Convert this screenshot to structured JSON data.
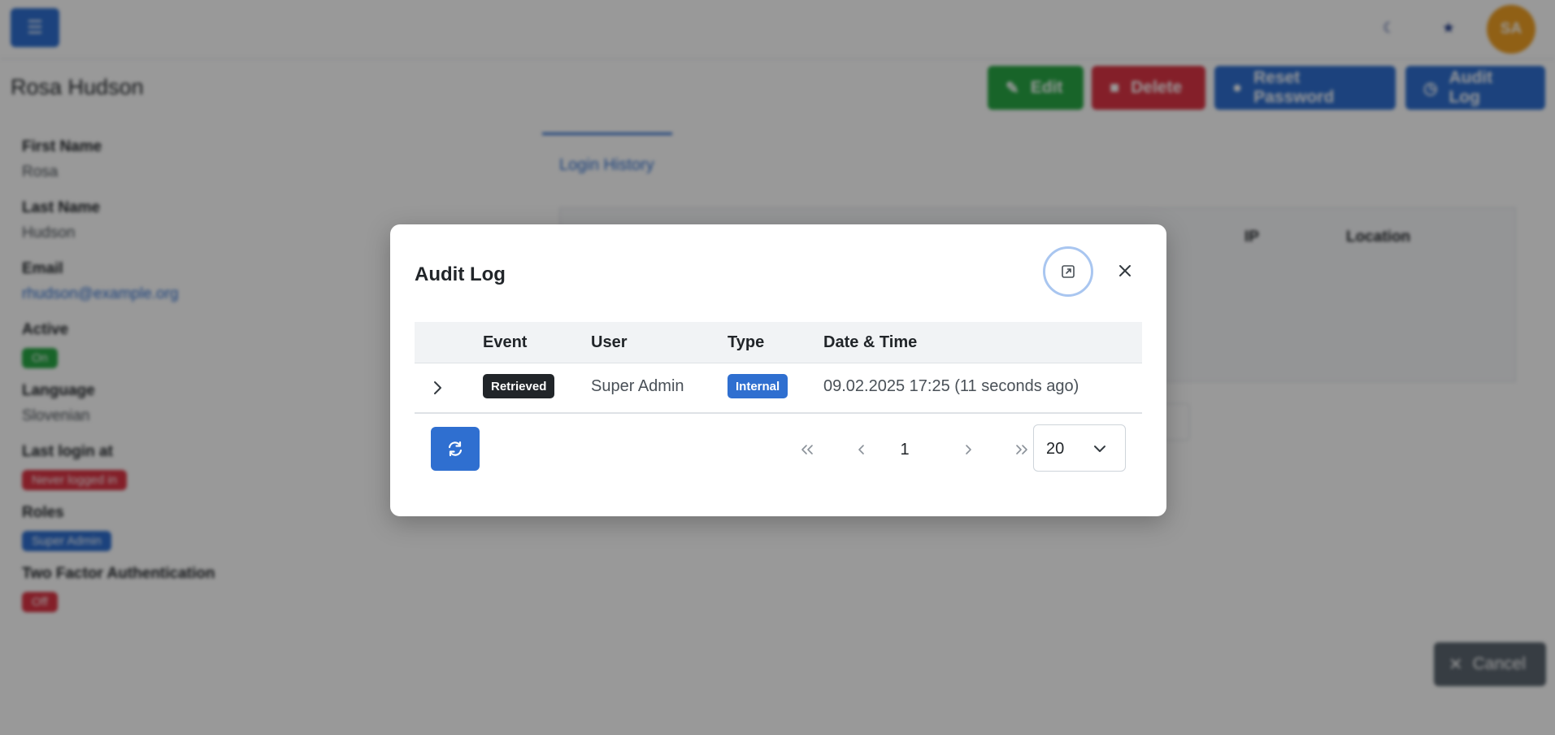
{
  "topbar": {
    "avatar_initials": "SA"
  },
  "page": {
    "title": "Rosa Hudson"
  },
  "header_buttons": {
    "edit": "Edit",
    "delete": "Delete",
    "reset_password": "Reset Password",
    "audit_log": "Audit Log"
  },
  "fields": [
    {
      "label": "First Name",
      "value": "Rosa"
    },
    {
      "label": "Last Name",
      "value": "Hudson"
    },
    {
      "label": "Email",
      "value": "rhudson@example.org"
    },
    {
      "label": "Active",
      "badge": "On"
    },
    {
      "label": "Language",
      "value": "Slovenian"
    },
    {
      "label": "Last login at",
      "badge": "Never logged in"
    },
    {
      "label": "Roles",
      "badge": "Super Admin"
    },
    {
      "label": "Two Factor Authentication",
      "badge": "Off"
    }
  ],
  "tabs": {
    "login_history": "Login History"
  },
  "login_table": {
    "headers": {
      "ip": "IP",
      "location": "Location"
    }
  },
  "cancel_label": "Cancel",
  "modal": {
    "title": "Audit Log",
    "table": {
      "headers": {
        "event": "Event",
        "user": "User",
        "type": "Type",
        "datetime": "Date & Time"
      },
      "rows": [
        {
          "event": "Retrieved",
          "user": "Super Admin",
          "type": "Internal",
          "datetime": "09.02.2025 17:25 (11 seconds ago)"
        }
      ]
    },
    "pagination": {
      "current_page": "1",
      "page_size": "20"
    }
  },
  "colors": {
    "primary": "#2f6fd0",
    "success": "#28a745",
    "danger": "#dc3545",
    "dark": "#212529",
    "avatar": "#f0a024",
    "secondary": "#5c6670"
  },
  "icons": [
    "menu-icon",
    "moon-icon",
    "star-icon",
    "pencil-icon",
    "trash-icon",
    "lock-icon",
    "history-icon",
    "expand-icon",
    "close-icon",
    "chevron-right-icon",
    "refresh-icon",
    "double-chevron-left-icon",
    "chevron-left-icon",
    "double-chevron-right-icon",
    "chevron-down-icon",
    "x-icon"
  ]
}
